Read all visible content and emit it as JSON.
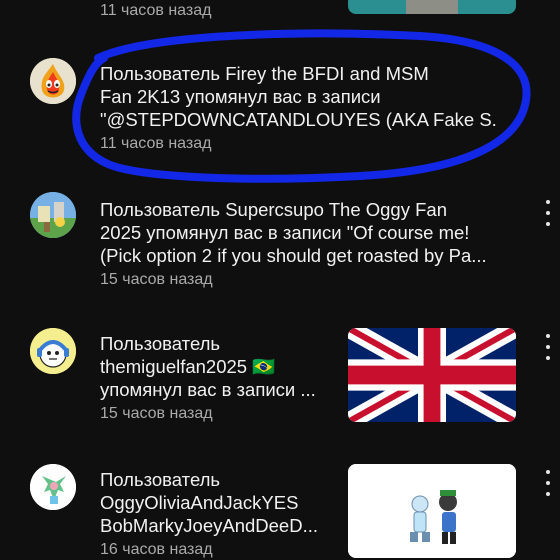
{
  "notifications": [
    {
      "time": "11 часов назад"
    },
    {
      "lines": [
        "Пользователь Firey the BFDI and MSM",
        "Fan 2K13 упомянул вас в записи",
        "\"@STEPDOWNCATANDLOUYES (AKA Fake S."
      ],
      "time": "11 часов назад"
    },
    {
      "lines": [
        "Пользователь Supercsupo The Oggy Fan",
        "2025 упомянул вас в записи \"Of course me!",
        "(Pick option 2 if you should get roasted by Pa..."
      ],
      "time": "15 часов назад"
    },
    {
      "lines": [
        "Пользователь",
        "themiguelfan2025 🇧🇷",
        "упомянул вас в записи ..."
      ],
      "time": "15 часов назад"
    },
    {
      "lines": [
        "Пользователь",
        "OggyOliviaAndJackYES",
        "BobMarkyJoeyAndDeeD..."
      ],
      "time": "16 часов назад"
    }
  ],
  "colors": {
    "background": "#0f0f0f",
    "primary_text": "#f1f1f1",
    "secondary_text": "#aaaaaa",
    "annotation_circle": "#1328e6"
  }
}
